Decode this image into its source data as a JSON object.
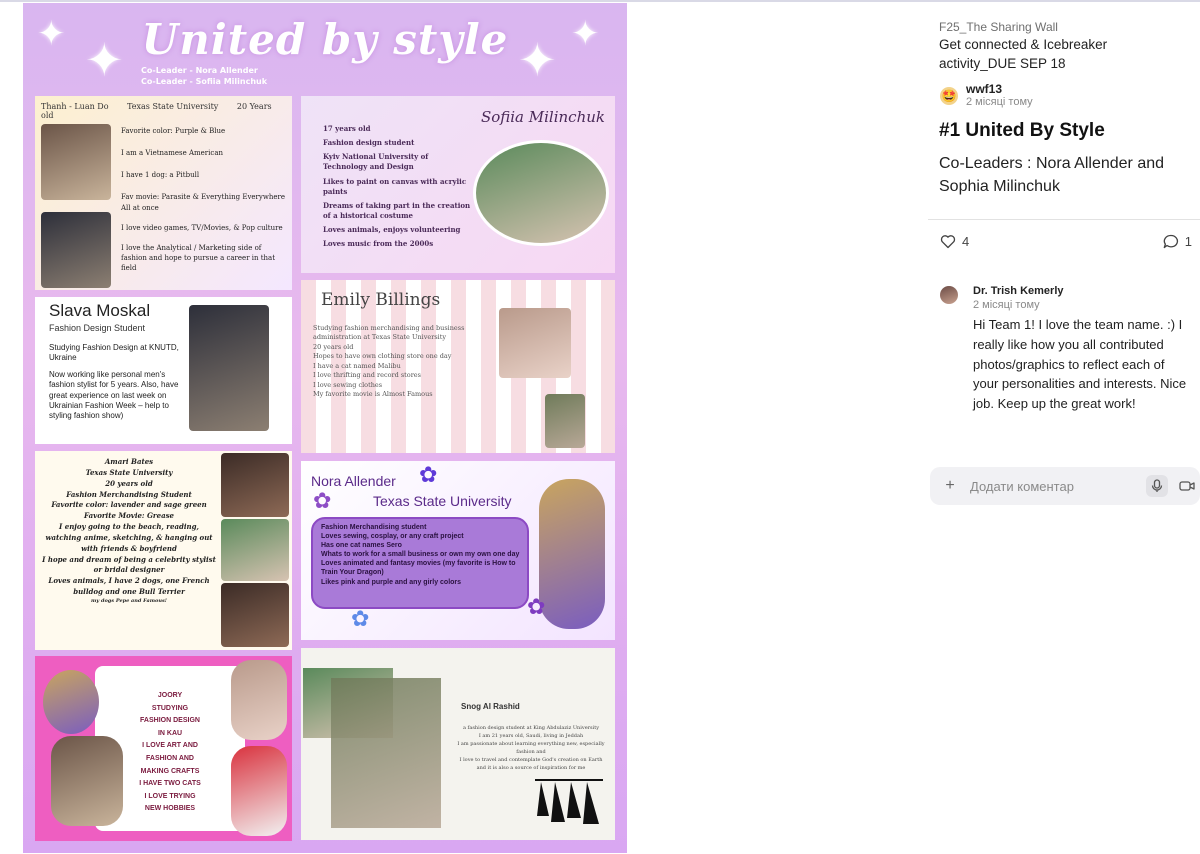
{
  "poster": {
    "title": "United by style",
    "co_leader_1": "Co-Leader - Nora Allender",
    "co_leader_2": "Co-Leader - Sofiia Milinchuk",
    "panel1": {
      "name": "Thanh - Luan Do",
      "school": "Texas State University",
      "age": "20 Years old",
      "lines": [
        "Favorite color: Purple & Blue",
        "I am a Vietnamese American",
        "I have 1 dog: a Pitbull",
        "Fav movie: Parasite & Everything Everywhere All at once",
        "I love video games, TV/Movies, & Pop culture",
        "I love the Analytical / Marketing side of fashion and hope to pursue a career in that field"
      ]
    },
    "panel2": {
      "name": "Sofiia Milinchuk",
      "lines": [
        "17 years old",
        "Fashion design student",
        "Kyiv National University of Technology and Design",
        "Likes to paint on canvas with acrylic paints",
        "Dreams of taking part in the creation of a historical costume",
        "Loves animals, enjoys volunteering",
        "Loves music from the 2000s"
      ]
    },
    "panel3": {
      "name": "Slava Moskal",
      "subtitle": "Fashion Design Student",
      "lines": [
        "Studying Fashion Design at KNUTD, Ukraine",
        "Now working like personal men's fashion stylist for 5 years. Also, have great experience on last week on Ukrainian Fashion Week – help to styling fashion show)"
      ]
    },
    "panel4": {
      "name": "Emily Billings",
      "lines": [
        "Studying fashion merchandising and business administration at Texas State University",
        "20 years old",
        "Hopes to have own clothing store one day",
        "I have a cat named Malibu",
        "I love thrifting and record stores",
        "I love sewing clothes",
        "My favorite movie is Almost Famous"
      ]
    },
    "panel5": {
      "lines": [
        "Amari Bates",
        "Texas State University",
        "20 years old",
        "Fashion Merchandising Student",
        "Favorite color: lavender and sage green",
        "Favorite Movie: Grease",
        "I enjoy going to the beach, reading, watching anime, sketching, & hanging out with friends & boyfriend",
        "I hope and dream of being a celebrity stylist or bridal designer",
        "Loves animals, I have 2 dogs, one French bulldog and one Bull Terrier",
        "my dogs Pepe and Famous!"
      ]
    },
    "panel6": {
      "name": "Nora Allender",
      "school": "Texas State University",
      "lines": [
        "Fashion Merchandising student",
        "Loves sewing, cosplay, or any craft project",
        "Has one cat names Sero",
        "Whats to work for a small business or own my own one day",
        "Loves animated and fantasy movies (my favorite is How to Train Your Dragon)",
        "Likes pink and purple and any girly colors"
      ]
    },
    "panel7": {
      "lines": [
        "JOORY",
        "STUDYING",
        "FASHION DESIGN",
        "IN KAU",
        "I LOVE ART AND",
        "FASHION AND",
        "MAKING CRAFTS",
        "I HAVE TWO CATS",
        "I LOVE TRYING",
        "NEW HOBBIES"
      ]
    },
    "panel8": {
      "name": "Snog Al Rashid",
      "lines": [
        "a fashion design student at King Abdulaziz University",
        "I am 21 years old, Saudi, living in Jeddah",
        "I am passionate about learning everything new, especially fashion and",
        "I love to travel and contemplate God's creation on Earth",
        "and it is also a source of inspiration for me"
      ]
    }
  },
  "sidebar": {
    "board": "F25_The Sharing Wall",
    "assignment": "Get connected & Icebreaker activity_DUE SEP 18",
    "author": "wwf13",
    "author_time": "2 місяці тому",
    "post_title": "#1 United By Style",
    "post_body": "Co-Leaders : Nora Allender and Sophia Milinchuk",
    "like_count": "4",
    "comment_count": "1",
    "comment": {
      "author": "Dr. Trish Kemerly",
      "time": "2 місяці тому",
      "body": "Hi Team 1! I love the team name. :) I really like how you all contributed photos/graphics to reflect each of your personalities and interests. Nice job. Keep up the great work!"
    },
    "comment_placeholder": "Додати коментар"
  },
  "colors": {
    "accent": "#7c4dff",
    "poster_bg": "#e2b3f0"
  },
  "icons": [
    "sparkle-icon",
    "heart-icon",
    "comment-icon",
    "plus-icon",
    "mic-icon",
    "video-icon"
  ]
}
